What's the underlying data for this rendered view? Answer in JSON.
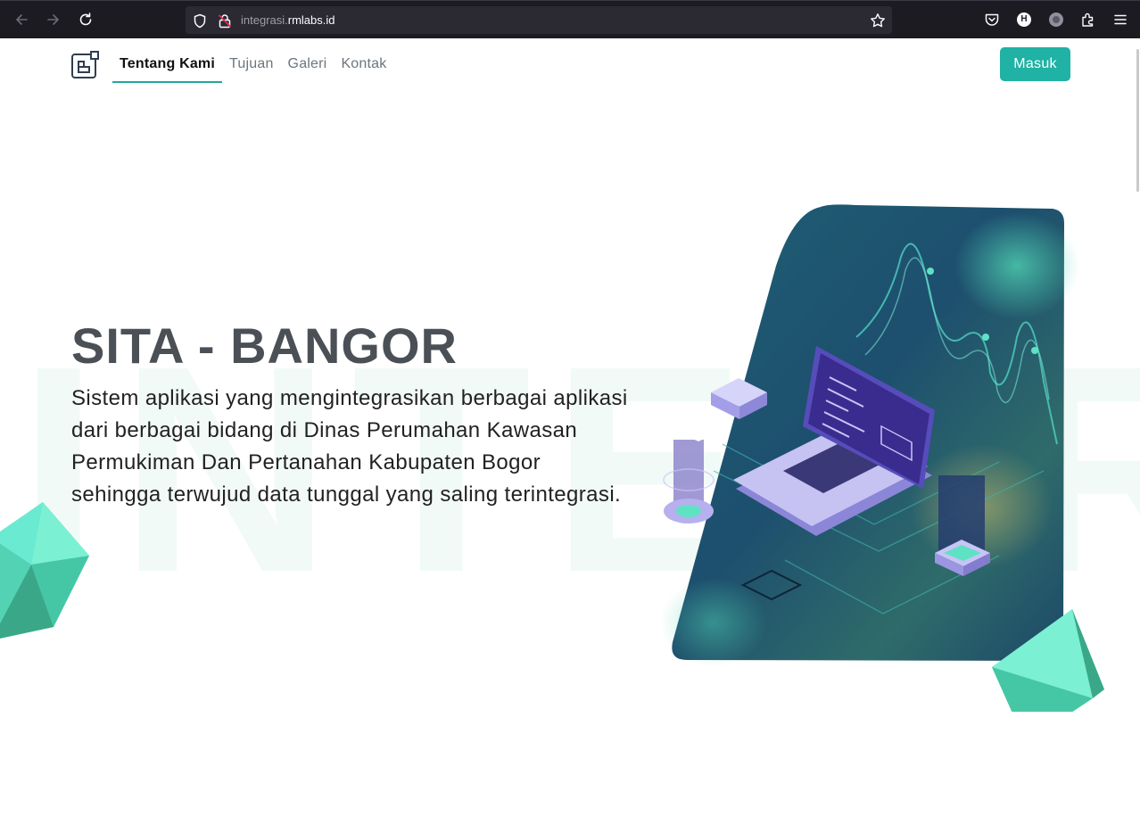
{
  "browser": {
    "url_prefix": "integrasi.",
    "url_domain": "rmlabs.id",
    "profile_initial": "H"
  },
  "nav": {
    "items": [
      {
        "label": "Tentang Kami",
        "active": true
      },
      {
        "label": "Tujuan",
        "active": false
      },
      {
        "label": "Galeri",
        "active": false
      },
      {
        "label": "Kontak",
        "active": false
      }
    ],
    "login_label": "Masuk"
  },
  "hero": {
    "watermark": "INTEGR",
    "title": "SITA - BANGOR",
    "description": "Sistem aplikasi yang mengintegrasikan berbagai aplikasi dari berbagai bidang di Dinas Perumahan Kawasan Permukiman Dan Pertanahan Kabupaten Bogor sehingga terwujud data tunggal yang saling terintegrasi."
  },
  "colors": {
    "accent": "#20b2a4",
    "title": "#4a5056",
    "chrome_bg": "#1c1b22"
  }
}
